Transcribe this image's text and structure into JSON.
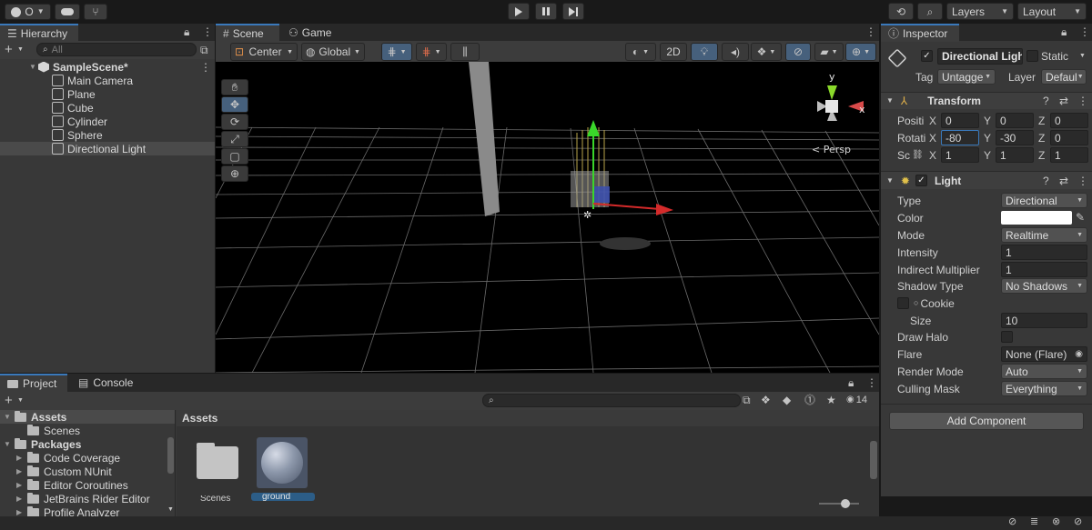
{
  "toolbar": {
    "account_label": "O",
    "layers_label": "Layers",
    "layout_label": "Layout"
  },
  "hierarchy": {
    "tab": "Hierarchy",
    "search_placeholder": "All",
    "scene": "SampleScene*",
    "items": [
      "Main Camera",
      "Plane",
      "Cube",
      "Cylinder",
      "Sphere",
      "Directional Light"
    ]
  },
  "scene_view": {
    "tab_scene": "Scene",
    "tab_game": "Game",
    "pivot": "Center",
    "space": "Global",
    "mode_2d": "2D",
    "persp": "< Persp",
    "gizmo_x": "x",
    "gizmo_y": "y"
  },
  "inspector": {
    "tab": "Inspector",
    "object_name": "Directional Ligh",
    "static_label": "Static",
    "tag_label": "Tag",
    "tag_value": "Untagge",
    "layer_label": "Layer",
    "layer_value": "Defaul",
    "transform": {
      "title": "Transform",
      "position_label": "Positi",
      "rotation_label": "Rotati",
      "scale_label": "Sc",
      "position": {
        "x": "0",
        "y": "0",
        "z": "0"
      },
      "rotation": {
        "x": "-80",
        "y": "-30",
        "z": "0"
      },
      "scale": {
        "x": "1",
        "y": "1",
        "z": "1"
      },
      "axis_x": "X",
      "axis_y": "Y",
      "axis_z": "Z"
    },
    "light": {
      "title": "Light",
      "type_label": "Type",
      "type_value": "Directional",
      "color_label": "Color",
      "color_value": "#ffffff",
      "mode_label": "Mode",
      "mode_value": "Realtime",
      "intensity_label": "Intensity",
      "intensity_value": "1",
      "indirect_label": "Indirect Multiplier",
      "indirect_value": "1",
      "shadow_label": "Shadow Type",
      "shadow_value": "No Shadows",
      "cookie_label": "Cookie",
      "size_label": "Size",
      "size_value": "10",
      "halo_label": "Draw Halo",
      "flare_label": "Flare",
      "flare_value": "None (Flare)",
      "render_label": "Render Mode",
      "render_value": "Auto",
      "culling_label": "Culling Mask",
      "culling_value": "Everything"
    },
    "add_component": "Add Component"
  },
  "project": {
    "tab_project": "Project",
    "tab_console": "Console",
    "hidden_count": "14",
    "assets_header": "Assets",
    "tree": {
      "assets": "Assets",
      "scenes": "Scenes",
      "packages": "Packages",
      "package_items": [
        "Code Coverage",
        "Custom NUnit",
        "Editor Coroutines",
        "JetBrains Rider Editor",
        "Profile Analyzer"
      ]
    },
    "grid_items": [
      {
        "label": "Scenes"
      },
      {
        "label": "ground"
      }
    ]
  }
}
